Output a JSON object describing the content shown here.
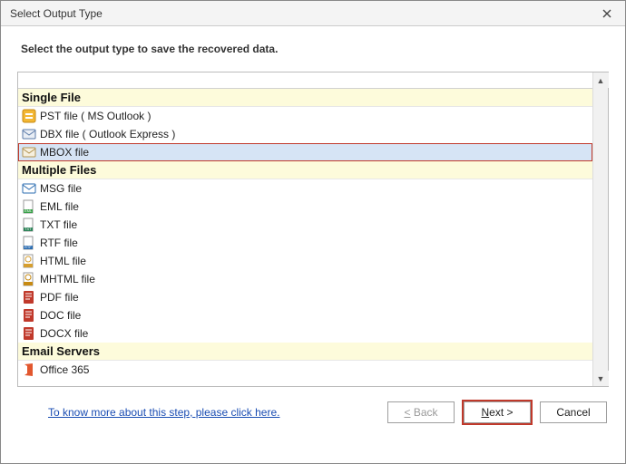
{
  "titlebar": {
    "title": "Select Output Type"
  },
  "instruction": "Select the output type to save the recovered data.",
  "categories": {
    "single": "Single File",
    "multiple": "Multiple Files",
    "servers": "Email Servers"
  },
  "items": {
    "pst": "PST file ( MS Outlook )",
    "dbx": "DBX file ( Outlook Express )",
    "mbox": "MBOX file",
    "msg": "MSG file",
    "eml": "EML file",
    "txt": "TXT file",
    "rtf": "RTF file",
    "html": "HTML file",
    "mhtml": "MHTML file",
    "pdf": "PDF file",
    "doc": "DOC file",
    "docx": "DOCX file",
    "o365": "Office 365"
  },
  "footer": {
    "help_link": "To know more about this step, please click here.",
    "back": "< Back",
    "next": "Next >",
    "cancel": "Cancel"
  }
}
